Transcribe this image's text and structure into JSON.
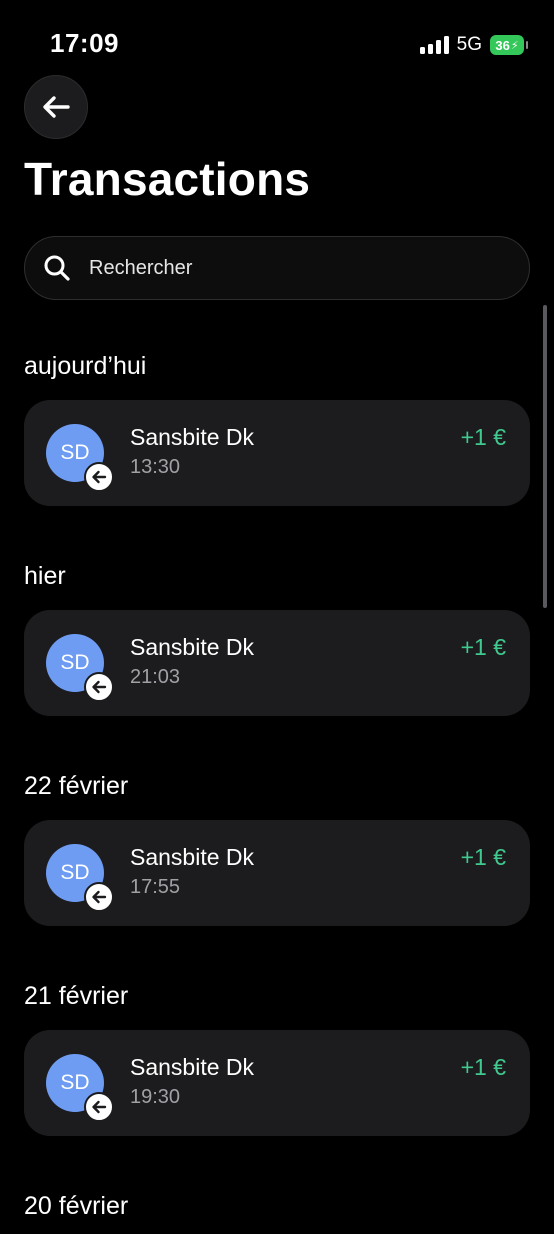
{
  "status_bar": {
    "time": "17:09",
    "network": "5G",
    "battery": "36"
  },
  "header": {
    "title": "Transactions"
  },
  "search": {
    "placeholder": "Rechercher"
  },
  "groups": [
    {
      "heading": "aujourd’hui",
      "transactions": [
        {
          "initials": "SD",
          "name": "Sansbite Dk",
          "time": "13:30",
          "amount": "+1 €"
        }
      ]
    },
    {
      "heading": "hier",
      "transactions": [
        {
          "initials": "SD",
          "name": "Sansbite Dk",
          "time": "21:03",
          "amount": "+1 €"
        }
      ]
    },
    {
      "heading": "22 février",
      "transactions": [
        {
          "initials": "SD",
          "name": "Sansbite Dk",
          "time": "17:55",
          "amount": "+1 €"
        }
      ]
    },
    {
      "heading": "21 février",
      "transactions": [
        {
          "initials": "SD",
          "name": "Sansbite Dk",
          "time": "19:30",
          "amount": "+1 €"
        }
      ]
    },
    {
      "heading": "20 février",
      "transactions": []
    }
  ],
  "icons": {
    "back": "arrow-left-icon",
    "search": "search-icon",
    "direction": "incoming-arrow-icon"
  },
  "colors": {
    "background": "#000000",
    "card": "#1c1c1e",
    "avatar": "#6e9cf3",
    "amount_positive": "#3fc98f",
    "battery": "#34c759"
  }
}
